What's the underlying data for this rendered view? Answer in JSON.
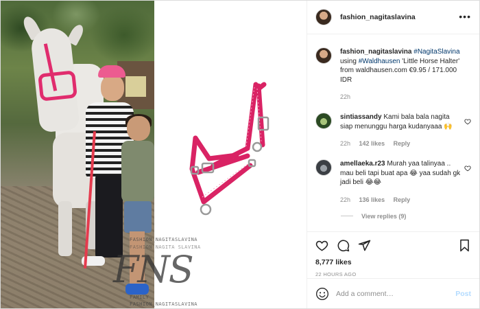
{
  "post": {
    "username": "fashion_nagitaslavina",
    "more_icon": "more-horizontal-icon",
    "caption": {
      "username": "fashion_nagitaslavina",
      "hashtag1": "#NagitaSlavina",
      "text1": "using",
      "hashtag2": "#Waldhausen",
      "text2": "'Little Horse Halter' from waldhausen.com €9.95 / 171.000 IDR",
      "time": "22h"
    },
    "comments": [
      {
        "username": "sintiassandy",
        "text": "Kami bala bala nagita siap menunggu harga kudanyaaa 🙌",
        "time": "22h",
        "likes": "142 likes",
        "reply": "Reply"
      },
      {
        "username": "amellaeka.r23",
        "text": "Murah yaa talinyaa .. mau beli tapi buat apa 😂 yaa sudah gk jadi beli 😂😂",
        "time": "22h",
        "likes": "136 likes",
        "reply": "Reply"
      }
    ],
    "view_replies": "View replies (9)",
    "likes": "8,777 likes",
    "time_ago": "22 HOURS AGO",
    "add_comment_placeholder": "Add a comment…",
    "post_button": "Post"
  },
  "watermark": {
    "line1": "FASHION_NAGITASLAVINA",
    "line2": "FASHION NAGITA SLAVINA",
    "monogram": "FNS",
    "line3": "FAMILY",
    "line4": "FASHION_NAGITASLAVINA"
  },
  "colors": {
    "halter": "#e02c6d",
    "link": "#00376b",
    "post_button": "#b3dbff"
  }
}
